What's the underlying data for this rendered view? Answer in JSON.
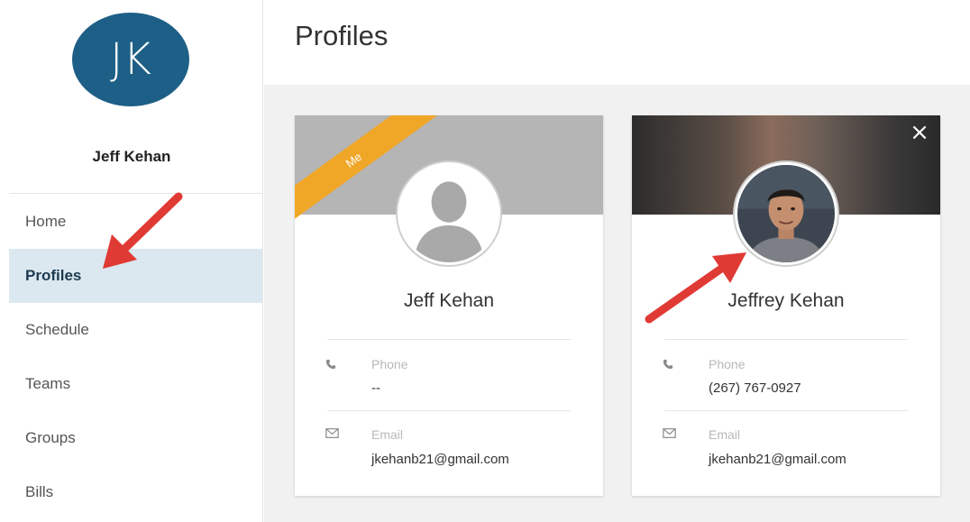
{
  "user": {
    "initials": "JK",
    "name": "Jeff Kehan"
  },
  "nav": {
    "items": [
      {
        "label": "Home"
      },
      {
        "label": "Profiles"
      },
      {
        "label": "Schedule"
      },
      {
        "label": "Teams"
      },
      {
        "label": "Groups"
      },
      {
        "label": "Bills"
      }
    ],
    "active": "Profiles"
  },
  "page": {
    "title": "Profiles"
  },
  "cards": [
    {
      "ribbon": "Me",
      "name": "Jeff Kehan",
      "phone_label": "Phone",
      "phone_value": "--",
      "email_label": "Email",
      "email_value": "jkehanb21@gmail.com"
    },
    {
      "close": "×",
      "name": "Jeffrey Kehan",
      "phone_label": "Phone",
      "phone_value": "(267) 767-0927",
      "email_label": "Email",
      "email_value": "jkehanb21@gmail.com"
    }
  ],
  "colors": {
    "avatar_bg": "#1d5f86",
    "active_nav_bg": "#dbe8f0",
    "ribbon": "#f0a627",
    "annotation_arrow": "#e03a34"
  },
  "icons": {
    "phone": "phone-icon",
    "email": "envelope-icon",
    "close": "close-icon",
    "avatar_placeholder": "person-silhouette-icon"
  }
}
